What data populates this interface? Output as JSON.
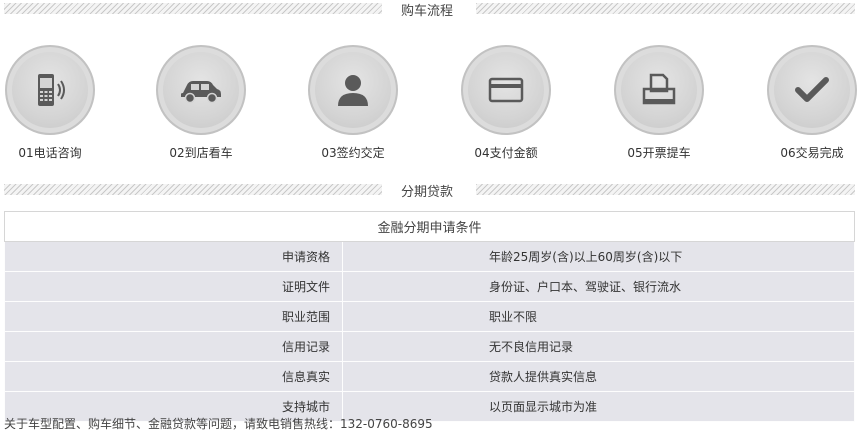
{
  "purchase_flow": {
    "title": "购车流程",
    "steps": [
      {
        "label": "01电话咨询",
        "icon": "phone-icon"
      },
      {
        "label": "02到店看车",
        "icon": "car-icon"
      },
      {
        "label": "03签约交定",
        "icon": "person-icon"
      },
      {
        "label": "04支付金额",
        "icon": "card-icon"
      },
      {
        "label": "05开票提车",
        "icon": "printer-icon"
      },
      {
        "label": "06交易完成",
        "icon": "checkmark-icon"
      }
    ]
  },
  "loan": {
    "title": "分期贷款",
    "table_title": "金融分期申请条件",
    "rows": [
      {
        "key": "申请资格",
        "value": "年龄25周岁(含)以上60周岁(含)以下"
      },
      {
        "key": "证明文件",
        "value": "身份证、户口本、驾驶证、银行流水"
      },
      {
        "key": "职业范围",
        "value": "职业不限"
      },
      {
        "key": "信用记录",
        "value": "无不良信用记录"
      },
      {
        "key": "信息真实",
        "value": "贷款人提供真实信息"
      },
      {
        "key": "支持城市",
        "value": "以页面显示城市为准"
      }
    ]
  },
  "footer": {
    "text": "关于车型配置、购车细节、金融贷款等问题，请致电销售热线：132-0760-8695"
  }
}
